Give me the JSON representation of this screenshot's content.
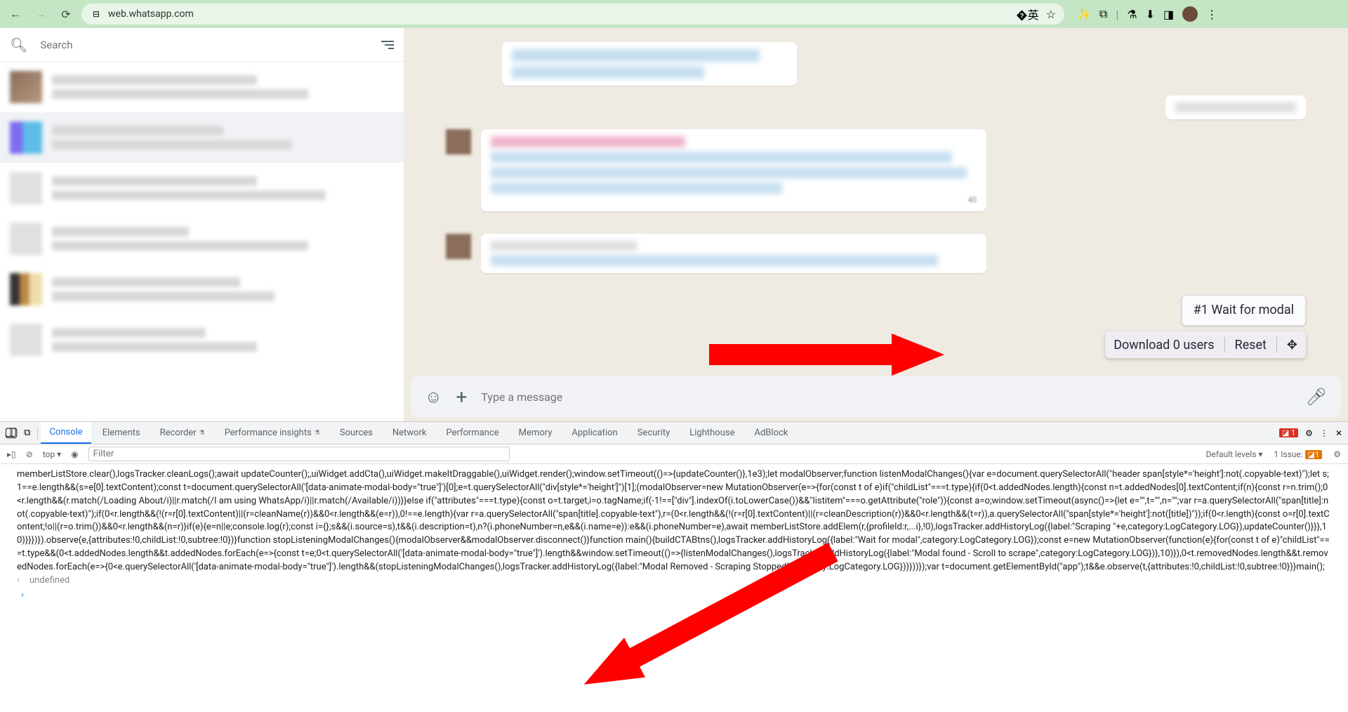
{
  "browser": {
    "url": "web.whatsapp.com"
  },
  "sidebar": {
    "search_placeholder": "Search"
  },
  "widget": {
    "log_line": "#1 Wait for modal",
    "download_label": "Download 0 users",
    "reset_label": "Reset"
  },
  "compose": {
    "placeholder": "Type a message"
  },
  "devtools": {
    "tabs": [
      "Console",
      "Elements",
      "Recorder",
      "Performance insights",
      "Sources",
      "Network",
      "Performance",
      "Memory",
      "Application",
      "Security",
      "Lighthouse",
      "AdBlock"
    ],
    "err_count": "1",
    "context": "top",
    "filter_placeholder": "Filter",
    "levels": "Default levels",
    "issues_label": "1 Issue:",
    "issue_count": "1",
    "code": "memberListStore.clear(),logsTracker.cleanLogs();await updateCounter();,uiWidget.addCta(),uiWidget.makeItDraggable(),uiWidget.render();window.setTimeout(()=>{updateCounter()},1e3);let modalObserver;function listenModalChanges(){var e=document.querySelectorAll(\"header span[style*='height']:not(.copyable-text)\");let s;1==e.length&&(s=e[0].textContent);const t=document.querySelectorAll('[data-animate-modal-body=\"true\"]')[0];e=t.querySelectorAll(\"div[style*='height']\")[1];(modalObserver=new MutationObserver(e=>{for(const t of e)if(\"childList\"===t.type){if(0<t.addedNodes.length){const n=t.addedNodes[0].textContent;if(n){const r=n.trim();0<r.length&&(r.match(/Loading About/i)||r.match(/I am using WhatsApp/i)||r.match(/Available/i))}}else if(\"attributes\"===t.type){const o=t.target,i=o.tagName;if(-1!==[\"div\"].indexOf(i.toLowerCase())&&\"listitem\"===o.getAttribute(\"role\")){const a=o;window.setTimeout(async()=>{let e=\"\",t=\"\",n=\"\";var r=a.querySelectorAll(\"span[title]:not(.copyable-text)\");if(0<r.length&&(!(r=r[0].textContent)||(r=cleanName(r))&&0<r.length&&(e=r)),0!==e.length){var r=a.querySelectorAll(\"span[title].copyable-text\"),r=(0<r.length&&(!(r=r[0].textContent)||(r=cleanDescription(r))&&0<r.length&&(t=r)),a.querySelectorAll(\"span[style*='height']:not([title])\"));if(0<r.length){const o=r[0].textContent;!o||(r=o.trim())&&0<r.length&&(n=r)}if(e){e=n||e;console.log(r);const i={};s&&(i.source=s),t&&(i.description=t),n?(i.phoneNumber=n,e&&(i.name=e)):e&&(i.phoneNumber=e),await memberListStore.addElem(r,{profileId:r,...i},!0),logsTracker.addHistoryLog({label:\"Scraping \"+e,category:LogCategory.LOG}),updateCounter()}}},10)}}})}).observe(e,{attributes:!0,childList:!0,subtree:!0})}function stopListeningModalChanges(){modalObserver&&modalObserver.disconnect()}function main(){buildCTABtns(),logsTracker.addHistoryLog({label:\"Wait for modal\",category:LogCategory.LOG});const e=new MutationObserver(function(e){for(const t of e)\"childList\"===t.type&&(0<t.addedNodes.length&&t.addedNodes.forEach(e=>{const t=e;0<t.querySelectorAll('[data-animate-modal-body=\"true\"]').length&&window.setTimeout(()=>{listenModalChanges(),logsTracker.addHistoryLog({label:\"Modal found - Scroll to scrape\",category:LogCategory.LOG})},10)}),0<t.removedNodes.length&&t.removedNodes.forEach(e=>{0<e.querySelectorAll('[data-animate-modal-body=\"true\"]').length&&(stopListeningModalChanges(),logsTracker.addHistoryLog({label:\"Modal Removed - Scraping Stopped\",category:LogCategory.LOG}))}))});var t=document.getElementById(\"app\");t&&e.observe(t,{attributes:!0,childList:!0,subtree:!0})}main();",
    "undefined": "undefined",
    "prompt": "›"
  }
}
